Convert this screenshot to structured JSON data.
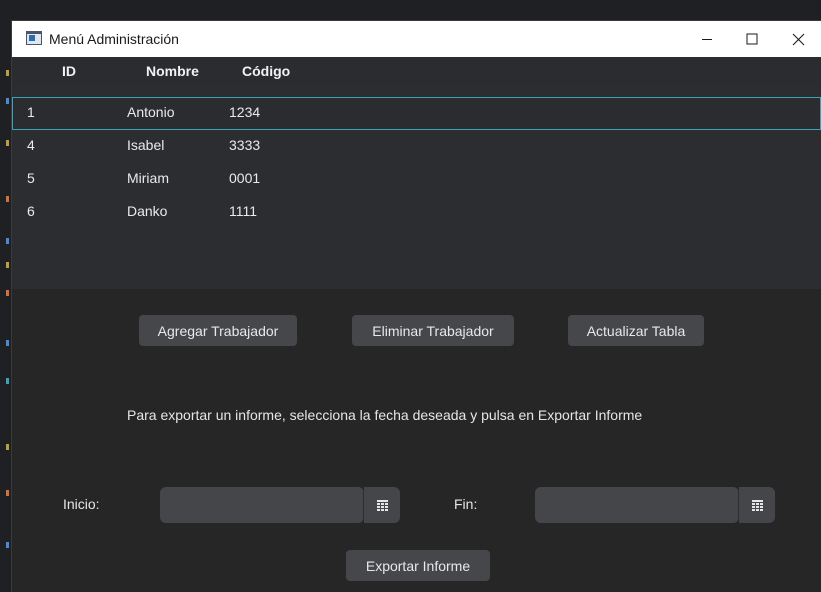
{
  "window": {
    "title": "Menú Administración"
  },
  "table": {
    "columns": [
      "ID",
      "Nombre",
      "Código"
    ],
    "rows": [
      {
        "id": "1",
        "nombre": "Antonio",
        "codigo": "1234"
      },
      {
        "id": "4",
        "nombre": "Isabel",
        "codigo": "3333"
      },
      {
        "id": "5",
        "nombre": "Miriam",
        "codigo": "0001"
      },
      {
        "id": "6",
        "nombre": "Danko",
        "codigo": "1111"
      }
    ]
  },
  "actions": {
    "add": "Agregar Trabajador",
    "remove": "Eliminar Trabajador",
    "refresh": "Actualizar Tabla"
  },
  "report": {
    "instructions": "Para exportar un informe, selecciona la fecha deseada y pulsa en Exportar Informe",
    "start_label": "Inicio:",
    "start_value": "",
    "end_label": "Fin:",
    "end_value": "",
    "export": "Exportar Informe"
  },
  "icons": {
    "window": "app-window-icon",
    "minimize": "minimize-icon",
    "maximize": "maximize-icon",
    "close": "close-icon",
    "calendar": "calendar-icon"
  },
  "colors": {
    "accent": "#3aa3b8",
    "background": "#262626",
    "table": "#2c2d31",
    "button": "#46474b"
  }
}
